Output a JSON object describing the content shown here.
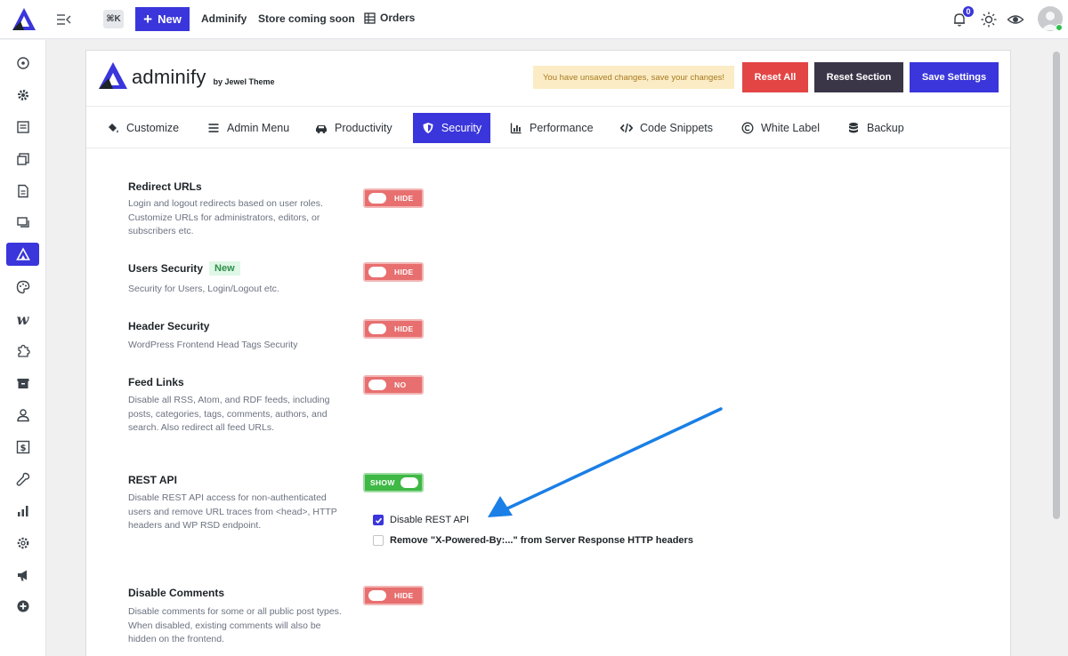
{
  "topbar": {
    "cmdk_label": "⌘K",
    "new_label": "New",
    "links": [
      "Adminify",
      "Store coming soon",
      "Orders"
    ],
    "notification_count": "0"
  },
  "brand": {
    "name": "adminify",
    "by": "by Jewel Theme"
  },
  "header": {
    "notice": "You have unsaved changes, save your changes!",
    "reset_all": "Reset All",
    "reset_section": "Reset Section",
    "save_settings": "Save Settings"
  },
  "tabs": [
    {
      "label": "Customize",
      "icon": "paint-bucket-icon"
    },
    {
      "label": "Admin Menu",
      "icon": "menu-lines-icon"
    },
    {
      "label": "Productivity",
      "icon": "car-icon"
    },
    {
      "label": "Security",
      "icon": "shield-icon",
      "active": true
    },
    {
      "label": "Performance",
      "icon": "bar-chart-icon"
    },
    {
      "label": "Code Snippets",
      "icon": "code-icon"
    },
    {
      "label": "White Label",
      "icon": "copyright-icon"
    },
    {
      "label": "Backup",
      "icon": "database-icon"
    }
  ],
  "settings": [
    {
      "title": "Redirect URLs",
      "desc": "Login and logout redirects based on user roles. Customize URLs for administrators, editors, or subscribers etc.",
      "toggle": "HIDE",
      "state": "off"
    },
    {
      "title": "Users Security",
      "badge": "New",
      "desc": "Security for Users, Login/Logout etc.",
      "toggle": "HIDE",
      "state": "off"
    },
    {
      "title": "Header Security",
      "desc": "WordPress Frontend Head Tags Security",
      "toggle": "HIDE",
      "state": "off"
    },
    {
      "title": "Feed Links",
      "desc": "Disable all RSS, Atom, and RDF feeds, including posts, categories, tags, comments, authors, and search. Also redirect all feed URLs.",
      "toggle": "NO",
      "state": "off"
    },
    {
      "title": "REST API",
      "desc": "Disable REST API access for non-authenticated users and remove URL traces from <head>, HTTP headers and WP RSD endpoint.",
      "toggle": "SHOW",
      "state": "on"
    },
    {
      "title": "Disable Comments",
      "desc": "Disable comments for some or all public post types. When disabled, existing comments will also be hidden on the frontend.",
      "toggle": "HIDE",
      "state": "off"
    }
  ],
  "rest_options": [
    {
      "label": "Disable REST API",
      "checked": true
    },
    {
      "label": "Remove \"X-Powered-By:...\" from Server Response HTTP headers",
      "checked": false
    }
  ],
  "colors": {
    "accent": "#3a36db",
    "danger": "#e34545",
    "toggle_off": "#e86f6f",
    "toggle_on": "#3fb845",
    "annotation_arrow": "#1a7fe6"
  }
}
